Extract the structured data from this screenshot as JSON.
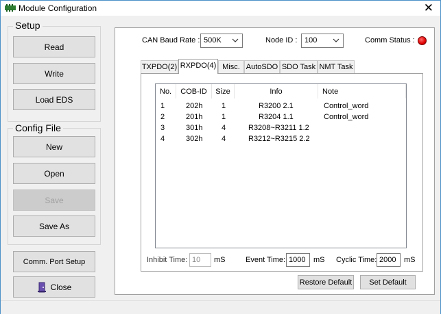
{
  "window": {
    "title": "Module Configuration",
    "close_glyph": "✕"
  },
  "setup": {
    "label": "Setup",
    "read": "Read",
    "write": "Write",
    "load_eds": "Load EDS"
  },
  "config_file": {
    "label": "Config File",
    "new": "New",
    "open": "Open",
    "save": "Save",
    "save_as": "Save As"
  },
  "comm_port_setup": "Comm. Port Setup",
  "close": "Close",
  "can_baud": {
    "label": "CAN Baud Rate :",
    "value": "500K"
  },
  "node_id": {
    "label": "Node ID :",
    "value": "100"
  },
  "comm_status": {
    "label": "Comm Status :",
    "color": "#e00000"
  },
  "tabs": [
    "TXPDO(2)",
    "RXPDO(4)",
    "Misc.",
    "AutoSDO",
    "SDO Task",
    "NMT Task"
  ],
  "active_tab": "RXPDO(4)",
  "table": {
    "headers": {
      "no": "No.",
      "cob": "COB-ID",
      "size": "Size",
      "info": "Info",
      "note": "Note"
    },
    "rows": [
      {
        "no": "1",
        "cob": "202h",
        "size": "1",
        "info": "R3200  2.1",
        "note": "Control_word"
      },
      {
        "no": "2",
        "cob": "201h",
        "size": "1",
        "info": "R3204  1.1",
        "note": "Control_word"
      },
      {
        "no": "3",
        "cob": "301h",
        "size": "4",
        "info": "R3208~R3211  1.2",
        "note": ""
      },
      {
        "no": "4",
        "cob": "302h",
        "size": "4",
        "info": "R3212~R3215  2.2",
        "note": ""
      }
    ]
  },
  "inhibit": {
    "label": "Inhibit Time:",
    "value": "10",
    "unit": "mS"
  },
  "event": {
    "label": "Event Time:",
    "value": "1000",
    "unit": "mS"
  },
  "cyclic": {
    "label": "Cyclic Time:",
    "value": "2000",
    "unit": "mS"
  },
  "restore_default": "Restore Default",
  "set_default": "Set Default"
}
